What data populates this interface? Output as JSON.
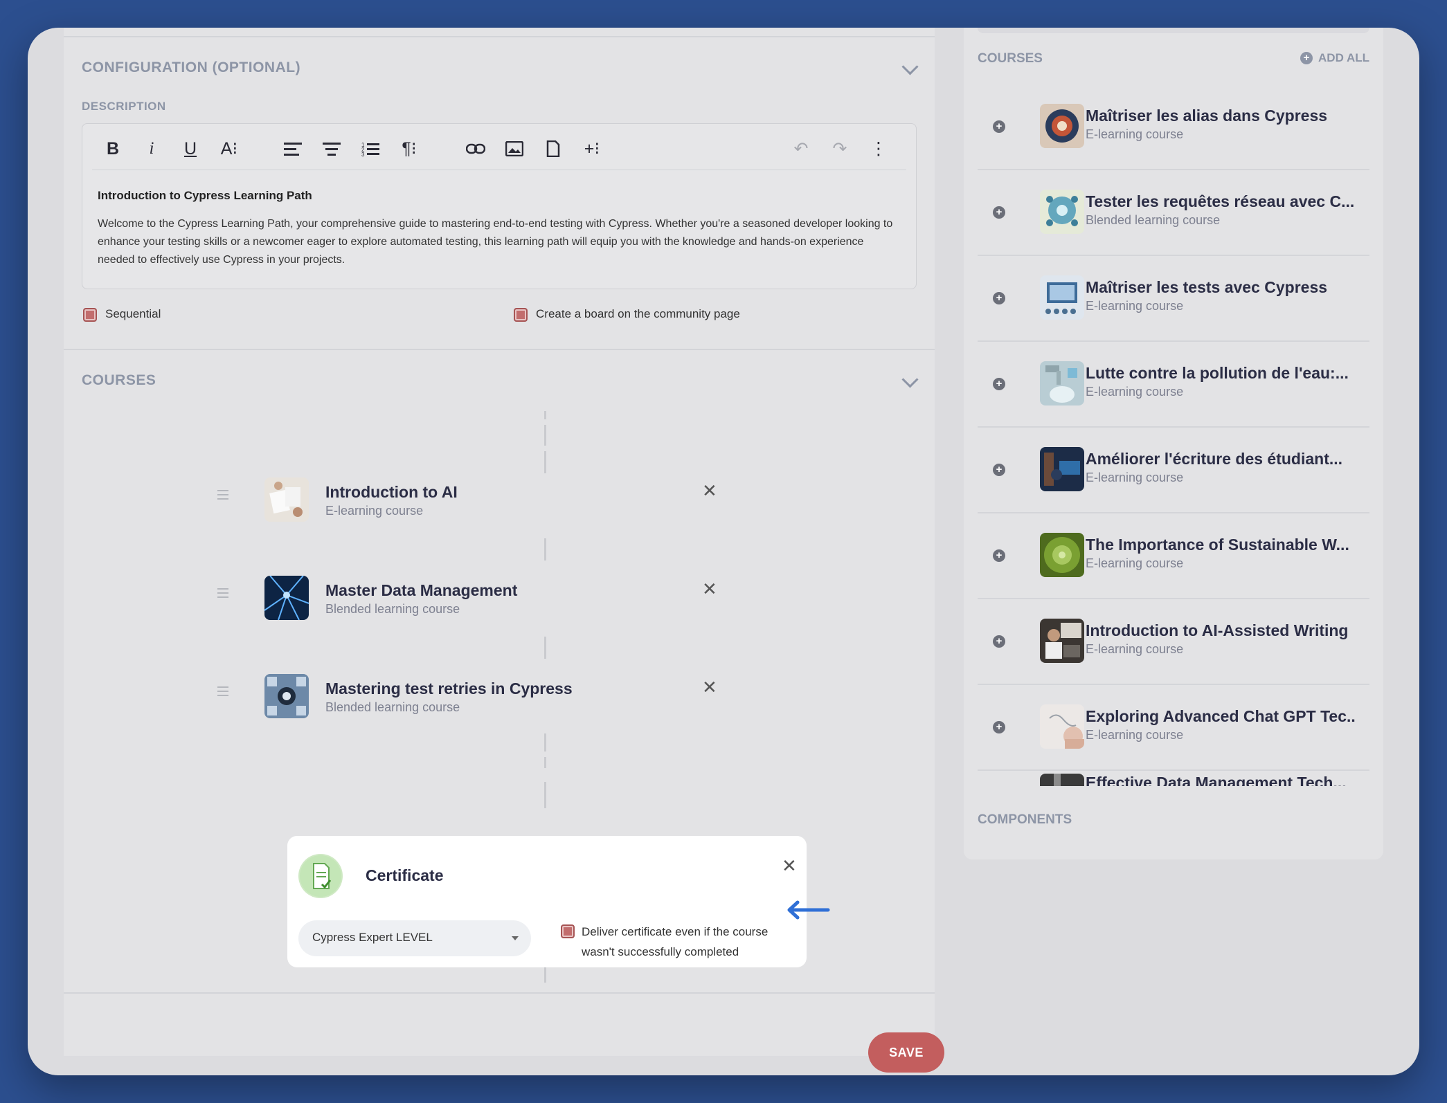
{
  "configuration": {
    "heading": "CONFIGURATION (OPTIONAL)",
    "description_label": "DESCRIPTION",
    "editor": {
      "toolbar": [
        "bold-icon",
        "italic-icon",
        "underline-icon",
        "text-style-icon",
        "align-left-icon",
        "align-center-icon",
        "ordered-list-icon",
        "paragraph-icon",
        "link-icon",
        "image-icon",
        "file-icon",
        "insert-more-icon",
        "undo-icon",
        "redo-icon",
        "more-vertical-icon"
      ],
      "title": "Introduction to Cypress Learning Path",
      "body": "Welcome to the Cypress Learning Path, your comprehensive guide to mastering end-to-end testing with Cypress. Whether you're a seasoned developer looking to enhance your testing skills or a newcomer eager to explore automated testing, this learning path will equip you with the knowledge and hands-on experience needed to effectively use Cypress in your projects."
    },
    "sequential_label": "Sequential",
    "board_label": "Create a board on the community page"
  },
  "courses": {
    "heading": "COURSES",
    "items": [
      {
        "title": "Introduction to AI",
        "type": "E-learning course"
      },
      {
        "title": "Master Data Management",
        "type": "Blended learning course"
      },
      {
        "title": "Mastering test retries in Cypress",
        "type": "Blended learning course"
      }
    ]
  },
  "certificate": {
    "title": "Certificate",
    "selected": "Cypress Expert LEVEL",
    "deliver_label_1": "Deliver certificate even if the course",
    "deliver_label_2": "wasn't successfully completed"
  },
  "save_label": "SAVE",
  "sidebar": {
    "heading": "COURSES",
    "add_all": "ADD ALL",
    "items": [
      {
        "title": "Maîtriser les alias dans Cypress",
        "type": "E-learning course"
      },
      {
        "title": "Tester les requêtes réseau avec C...",
        "type": "Blended learning course"
      },
      {
        "title": "Maîtriser les tests avec Cypress",
        "type": "E-learning course"
      },
      {
        "title": "Lutte contre la pollution de l'eau:...",
        "type": "E-learning course"
      },
      {
        "title": "Améliorer l'écriture des étudiant...",
        "type": "E-learning course"
      },
      {
        "title": "The Importance of Sustainable W...",
        "type": "E-learning course"
      },
      {
        "title": "Introduction to AI-Assisted Writing",
        "type": "E-learning course"
      },
      {
        "title": "Exploring Advanced Chat GPT Tec...",
        "type": "E-learning course"
      },
      {
        "title": "Effective Data Management Tech..."
      }
    ],
    "components_heading": "COMPONENTS"
  },
  "colors": {
    "background": "#2c4f8f",
    "accent": "#c35e5e",
    "arrow": "#2f6fd6"
  }
}
